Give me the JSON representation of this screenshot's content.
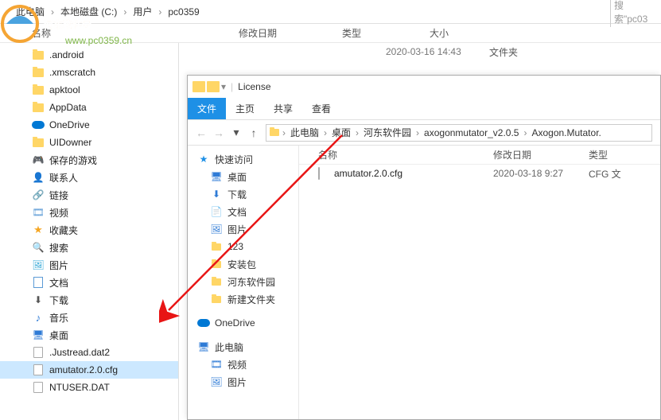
{
  "top": {
    "crumbs": [
      "此电脑",
      "本地磁盘 (C:)",
      "用户",
      "pc0359"
    ],
    "search_placeholder": "搜索\"pc03"
  },
  "cols1": {
    "name": "名称",
    "date": "修改日期",
    "type": "类型",
    "size": "大小"
  },
  "row_hidden": {
    "date": "2020-03-16 14:43",
    "type": "文件夹"
  },
  "sidebar": {
    "items": [
      {
        "label": ".android",
        "icon": "folder"
      },
      {
        "label": ".xmscratch",
        "icon": "folder"
      },
      {
        "label": "apktool",
        "icon": "folder"
      },
      {
        "label": "AppData",
        "icon": "folder"
      },
      {
        "label": "OneDrive",
        "icon": "onedrive"
      },
      {
        "label": "UIDowner",
        "icon": "folder"
      },
      {
        "label": "保存的游戏",
        "icon": "disk"
      },
      {
        "label": "联系人",
        "icon": "contact"
      },
      {
        "label": "链接",
        "icon": "link"
      },
      {
        "label": "视频",
        "icon": "video"
      },
      {
        "label": "收藏夹",
        "icon": "star"
      },
      {
        "label": "搜索",
        "icon": "search"
      },
      {
        "label": "图片",
        "icon": "pic"
      },
      {
        "label": "文档",
        "icon": "doc"
      },
      {
        "label": "下载",
        "icon": "down"
      },
      {
        "label": "音乐",
        "icon": "music"
      },
      {
        "label": "桌面",
        "icon": "desk"
      },
      {
        "label": ".Justread.dat2",
        "icon": "file"
      },
      {
        "label": "amutator.2.0.cfg",
        "icon": "file",
        "selected": true
      },
      {
        "label": "NTUSER.DAT",
        "icon": "file"
      }
    ]
  },
  "w2": {
    "title": "License",
    "ribbon": {
      "file": "文件",
      "home": "主页",
      "share": "共享",
      "view": "查看"
    },
    "crumbs": [
      "此电脑",
      "桌面",
      "河东软件园",
      "axogonmutator_v2.0.5",
      "Axogon.Mutator."
    ],
    "cols": {
      "name": "名称",
      "date": "修改日期",
      "type": "类型"
    },
    "rows": [
      {
        "name": "amutator.2.0.cfg",
        "date": "2020-03-18 9:27",
        "type": "CFG 文"
      }
    ],
    "side": {
      "quick": "快速访问",
      "quick_items": [
        "桌面",
        "下载",
        "文档",
        "图片",
        "123",
        "安装包",
        "河东软件园",
        "新建文件夹"
      ],
      "onedrive": "OneDrive",
      "thispc": "此电脑",
      "pc_items": [
        "视频",
        "图片"
      ]
    }
  },
  "watermark": {
    "text": "河东软件园",
    "url": "www.pc0359.cn"
  }
}
